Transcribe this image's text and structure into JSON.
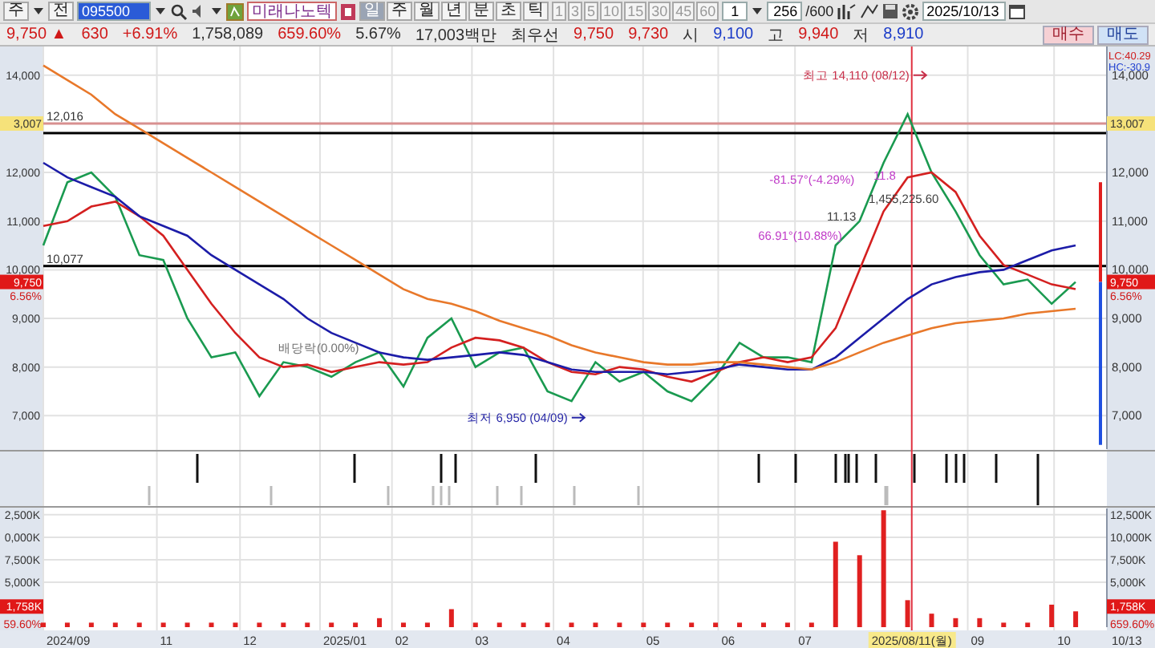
{
  "toolbar": {
    "market": "주",
    "all_button": "전",
    "code": {
      "value": "095500",
      "highlighted": true
    },
    "stock_name": "미래나노텍",
    "periods": [
      {
        "label": "일",
        "selected": true
      },
      {
        "label": "주",
        "selected": false
      },
      {
        "label": "월",
        "selected": false
      },
      {
        "label": "년",
        "selected": false
      },
      {
        "label": "분",
        "selected": false
      },
      {
        "label": "초",
        "selected": false
      },
      {
        "label": "틱",
        "selected": false
      }
    ],
    "intervals": [
      "1",
      "3",
      "5",
      "10",
      "15",
      "30",
      "45",
      "60"
    ],
    "multiplier": "1",
    "count": "256",
    "count_max": "/600",
    "date": "2025/10/13"
  },
  "quote": {
    "items": [
      {
        "text": "9,750 ▲",
        "color": "#d01818"
      },
      {
        "text": "630",
        "color": "#d01818"
      },
      {
        "text": "+6.91%",
        "color": "#d01818"
      },
      {
        "text": "1,758,089",
        "color": "#303030"
      },
      {
        "text": "659.60%",
        "color": "#d01818"
      },
      {
        "text": "5.67%",
        "color": "#303030"
      },
      {
        "text": "17,003백만",
        "color": "#303030"
      },
      {
        "text": "최우선",
        "color": "#303030"
      },
      {
        "text": "9,750",
        "color": "#d01818"
      },
      {
        "text": "9,730",
        "color": "#d01818"
      },
      {
        "text": "시",
        "color": "#303030"
      },
      {
        "text": "9,100",
        "color": "#1c3cc8"
      },
      {
        "text": "고",
        "color": "#303030"
      },
      {
        "text": "9,940",
        "color": "#d01818"
      },
      {
        "text": "저",
        "color": "#303030"
      },
      {
        "text": "8,910",
        "color": "#1c3cc8"
      }
    ],
    "buttons": [
      {
        "label": "매수",
        "kind": "buy"
      },
      {
        "label": "매도",
        "kind": "sell"
      }
    ]
  },
  "price_panel": {
    "readouts": [
      {
        "text": "LC:40.29",
        "color": "#d02020"
      },
      {
        "text": "HC:-30.9",
        "color": "#2040d0"
      }
    ],
    "left_ticks": [
      "14,000",
      "12,000",
      "11,000",
      "10,000",
      "9,000",
      "8,000",
      "7,000"
    ],
    "tags": [
      {
        "text": "3,007",
        "kind": "highlight"
      },
      {
        "text": "13,007",
        "kind": "highlight"
      },
      {
        "text": "9,750",
        "kind": "current"
      },
      {
        "text": "9,750",
        "kind": "current"
      },
      {
        "text": "6.56%",
        "kind": "percent"
      },
      {
        "text": "6.56%",
        "kind": "percent"
      }
    ],
    "lines": [
      {
        "label": "12,016",
        "color": "#d89090"
      },
      {
        "color": "#000000"
      },
      {
        "label": "10,077",
        "color": "#000000"
      }
    ],
    "notes": [
      {
        "text": "최고 14,110 (08/12)",
        "color": "#c8304a",
        "pointer": true
      },
      {
        "text": "최저 6,950 (04/09)",
        "color": "#2a2aa8",
        "pointer": true
      },
      {
        "text": "배당락(0.00%)",
        "color": "#707070",
        "pointer": false
      },
      {
        "text": "-81.57°(-4.29%)",
        "color": "#c03cc8",
        "pointer": false
      },
      {
        "text": "11.8",
        "color": "#c03cc8",
        "pointer": false
      },
      {
        "text": "1,455,225.60",
        "color": "#404040",
        "pointer": false
      },
      {
        "text": "11.13",
        "color": "#404040",
        "pointer": false
      },
      {
        "text": "66.91°(10.88%)",
        "color": "#c03cc8",
        "pointer": false
      }
    ],
    "chart_data": {
      "type": "line",
      "categories": [
        null,
        null,
        null,
        null,
        null,
        null,
        null,
        null,
        null,
        null,
        null,
        null,
        null,
        null,
        null,
        null,
        null,
        null,
        null,
        null,
        null,
        null,
        null,
        null,
        null,
        null,
        null,
        null,
        null,
        null,
        null,
        null,
        null,
        null,
        null,
        null,
        null,
        null,
        null,
        null,
        null,
        null,
        null,
        null
      ],
      "ylim": [
        6280,
        14590
      ],
      "yticks": [
        {
          "value": 14000,
          "label": "14,000"
        },
        {
          "value": 12000,
          "label": "12,000"
        },
        {
          "value": 11000,
          "label": "11,000"
        },
        {
          "value": 10000,
          "label": "10,000"
        },
        {
          "value": 9000,
          "label": "9,000"
        },
        {
          "value": 8000,
          "label": "8,000"
        },
        {
          "value": 7000,
          "label": "7,000"
        }
      ],
      "series": [
        {
          "color": "#1a9a50",
          "values": [
            10500,
            11800,
            12000,
            11500,
            10300,
            10200,
            9000,
            8200,
            8300,
            7400,
            8100,
            8000,
            7800,
            8100,
            8300,
            7600,
            8600,
            9000,
            8000,
            8300,
            8400,
            7500,
            7300,
            8100,
            7700,
            7900,
            7500,
            7300,
            7800,
            8500,
            8200,
            8200,
            8100,
            10500,
            11000,
            12200,
            13200,
            12000,
            11200,
            10300,
            9700,
            9800,
            9300,
            9750
          ]
        },
        {
          "color": "#d42020",
          "values": [
            10900,
            11000,
            11300,
            11400,
            11100,
            10700,
            10000,
            9300,
            8700,
            8200,
            8000,
            8050,
            7900,
            8000,
            8100,
            8050,
            8100,
            8400,
            8600,
            8550,
            8400,
            8100,
            7900,
            7850,
            8000,
            7950,
            7800,
            7700,
            7900,
            8100,
            8200,
            8100,
            8200,
            8800,
            10000,
            11200,
            11900,
            12000,
            11600,
            10700,
            10100,
            9900,
            9700,
            9600
          ]
        },
        {
          "color": "#1c1ca8",
          "values": [
            12200,
            11900,
            11700,
            11500,
            11100,
            10900,
            10700,
            10300,
            10000,
            9700,
            9400,
            9000,
            8700,
            8500,
            8300,
            8200,
            8150,
            8200,
            8250,
            8300,
            8250,
            8100,
            7950,
            7900,
            7900,
            7900,
            7850,
            7900,
            7950,
            8050,
            8000,
            7950,
            7950,
            8200,
            8600,
            9000,
            9400,
            9700,
            9850,
            9950,
            10000,
            10200,
            10400,
            10500
          ]
        },
        {
          "color": "#e8782a",
          "values": [
            14200,
            13900,
            13600,
            13200,
            12900,
            12600,
            12300,
            12000,
            11700,
            11400,
            11100,
            10800,
            10500,
            10200,
            9900,
            9600,
            9400,
            9300,
            9150,
            8950,
            8800,
            8650,
            8450,
            8300,
            8200,
            8100,
            8050,
            8050,
            8100,
            8100,
            8050,
            8000,
            7950,
            8100,
            8300,
            8500,
            8650,
            8800,
            8900,
            8950,
            9000,
            9100,
            9150,
            9200
          ]
        }
      ]
    }
  },
  "volume_panel": {
    "left_ticks": [
      "2,500K",
      "0,000K",
      "7,500K",
      "5,000K"
    ],
    "tags": [
      {
        "text": "1,758K",
        "kind": "current"
      },
      {
        "text": "1,758K",
        "kind": "current"
      },
      {
        "text": "59.60%",
        "kind": "percent"
      },
      {
        "text": "659.60%",
        "kind": "percent"
      }
    ],
    "chart_data": {
      "type": "bar",
      "categories": [
        null,
        null,
        null,
        null,
        null,
        null,
        null,
        null,
        null,
        null,
        null,
        null,
        null,
        null,
        null,
        null,
        null,
        null,
        null,
        null,
        null,
        null,
        null,
        null,
        null,
        null,
        null,
        null,
        null,
        null,
        null,
        null,
        null,
        null,
        null,
        null,
        null,
        null,
        null,
        null,
        null,
        null,
        null,
        null
      ],
      "ylim": [
        0,
        13200
      ],
      "yticks": [
        {
          "value": 12500,
          "label": "12,500K"
        },
        {
          "value": 10000,
          "label": "10,000K"
        },
        {
          "value": 7500,
          "label": "7,500K"
        },
        {
          "value": 5000,
          "label": "5,000K"
        }
      ],
      "series": [
        {
          "color": "#e02020",
          "values": [
            500,
            500,
            500,
            500,
            500,
            500,
            500,
            500,
            500,
            500,
            500,
            500,
            500,
            500,
            1000,
            500,
            500,
            2000,
            500,
            500,
            500,
            500,
            500,
            500,
            500,
            500,
            500,
            500,
            500,
            500,
            500,
            500,
            500,
            9500,
            8000,
            13000,
            3000,
            1500,
            1000,
            1000,
            500,
            500,
            2500,
            1758
          ]
        }
      ]
    }
  },
  "x_axis": {
    "ticks": [
      "2024/09",
      "11",
      "12",
      "2025/01",
      "02",
      "03",
      "04",
      "05",
      "06",
      "07",
      "09",
      "10"
    ],
    "crosshair_label": "2025/08/11(월)",
    "end_label": "10/13"
  }
}
